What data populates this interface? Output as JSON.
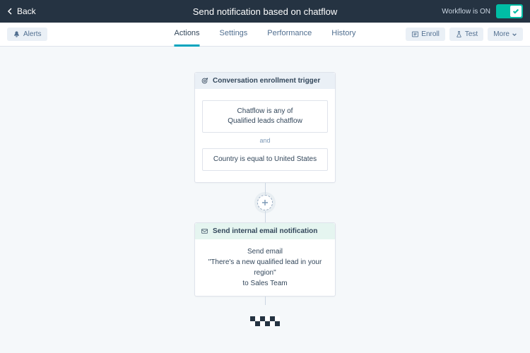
{
  "header": {
    "back_label": "Back",
    "title": "Send notification based on chatflow",
    "status_label": "Workflow is ON"
  },
  "toolbar": {
    "alerts_label": "Alerts",
    "tabs": [
      "Actions",
      "Settings",
      "Performance",
      "History"
    ],
    "enroll_label": "Enroll",
    "test_label": "Test",
    "more_label": "More"
  },
  "trigger_card": {
    "header": "Conversation enrollment trigger",
    "cond1_line1": "Chatflow is any of",
    "cond1_line2": "Qualified leads chatflow",
    "and": "and",
    "cond2": "Country is equal to United States"
  },
  "action_card": {
    "header": "Send internal email notification",
    "line1": "Send email",
    "line2": "\"There's a new qualified lead in your region\"",
    "line3": "to Sales Team"
  }
}
